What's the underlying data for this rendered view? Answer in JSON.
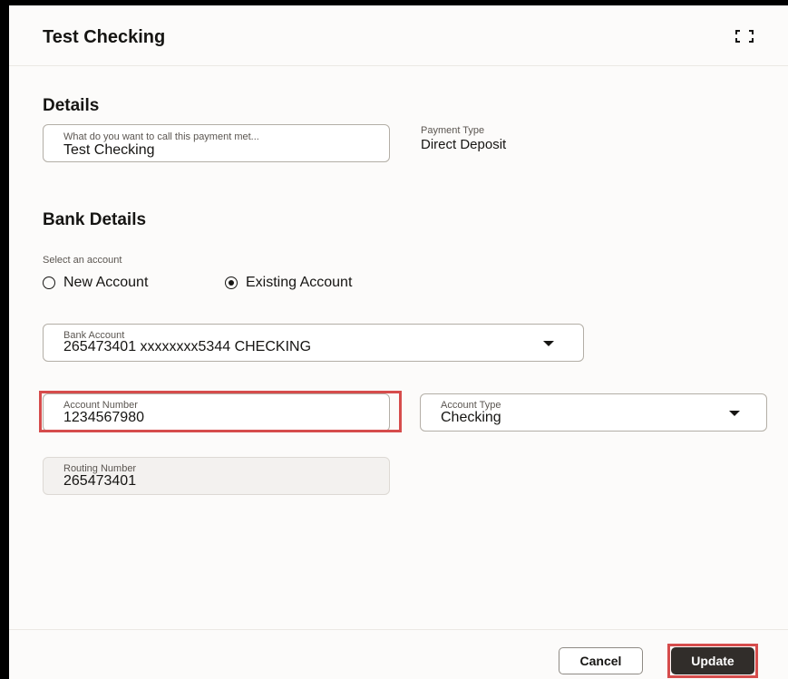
{
  "dialog": {
    "title": "Test Checking",
    "fullscreen_icon": "expand-corners-icon"
  },
  "details": {
    "section_title": "Details",
    "name_field": {
      "label": "What do you want to call this payment met...",
      "value": "Test Checking"
    },
    "payment_type": {
      "label": "Payment Type",
      "value": "Direct Deposit"
    }
  },
  "bank_details": {
    "section_title": "Bank Details",
    "select_label": "Select an account",
    "options": [
      {
        "label": "New Account",
        "checked": false
      },
      {
        "label": "Existing Account",
        "checked": true
      }
    ],
    "bank_account": {
      "label": "Bank Account",
      "value": "265473401  xxxxxxxx5344  CHECKING"
    },
    "account_number": {
      "label": "Account Number",
      "value": "1234567980"
    },
    "account_type": {
      "label": "Account Type",
      "value": "Checking"
    },
    "routing_number": {
      "label": "Routing Number",
      "value": "265473401"
    }
  },
  "footer": {
    "cancel_label": "Cancel",
    "update_label": "Update"
  },
  "colors": {
    "highlight": "#d64c4c",
    "primary_button": "#312d2a"
  }
}
